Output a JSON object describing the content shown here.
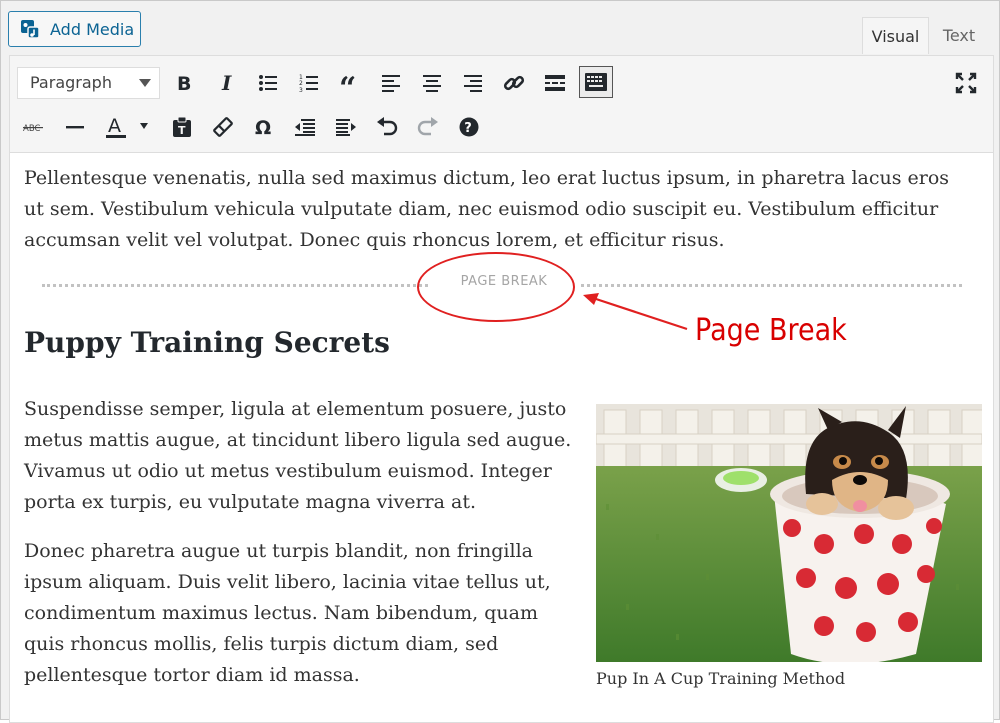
{
  "toolbar_top": {
    "add_media_label": "Add Media",
    "tabs": [
      {
        "label": "Visual",
        "active": true
      },
      {
        "label": "Text",
        "active": false
      }
    ]
  },
  "format_select": {
    "value": "Paragraph"
  },
  "toolbar_row1": [
    "bold-icon",
    "italic-icon",
    "bulleted-list-icon",
    "numbered-list-icon",
    "blockquote-icon",
    "align-left-icon",
    "align-center-icon",
    "align-right-icon",
    "link-icon",
    "read-more-icon",
    "toolbar-toggle-icon",
    "fullscreen-icon"
  ],
  "toolbar_row2": [
    "strikethrough-icon",
    "horizontal-line-icon",
    "text-color-icon",
    "paste-as-text-icon",
    "clear-formatting-icon",
    "special-character-icon",
    "outdent-icon",
    "indent-icon",
    "undo-icon",
    "redo-icon",
    "help-icon"
  ],
  "content": {
    "paragraph1": "Pellentesque venenatis, nulla sed maximus dictum, leo erat luctus ipsum, in pharetra lacus eros ut sem. Vestibulum vehicula vulputate diam, nec euismod odio suscipit eu. Vestibulum efficitur accumsan velit vel volutpat. Donec quis rhoncus lorem, et efficitur risus.",
    "page_break_label": "PAGE BREAK",
    "heading": "Puppy Training Secrets",
    "paragraph2": "Suspendisse semper, ligula at elementum posuere, justo metus mattis augue, at tincidunt libero ligula sed augue. Vivamus ut odio ut metus vestibulum euismod. Integer porta ex turpis, eu vulputate magna viverra at.",
    "paragraph3": "Donec pharetra augue ut turpis blandit, non fringilla ipsum aliquam. Duis velit libero, lacinia vitae tellus ut, condimentum maximus lectus. Nam bibendum, quam quis rhoncus mollis, felis turpis dictum diam, sed pellentesque tortor diam id massa.",
    "image_caption": "Pup In A Cup Training Method"
  },
  "annotation": {
    "label": "Page Break",
    "color": "#d80000"
  }
}
